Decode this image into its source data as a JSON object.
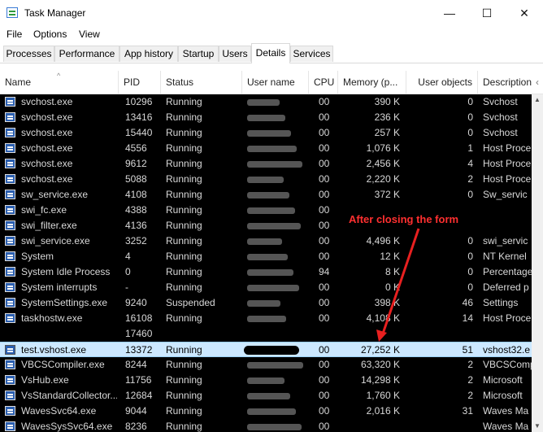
{
  "window": {
    "title": "Task Manager",
    "minimize_glyph": "—",
    "maximize_glyph": "☐",
    "close_glyph": "✕"
  },
  "menu": [
    "File",
    "Options",
    "View"
  ],
  "tabs": [
    "Processes",
    "Performance",
    "App history",
    "Startup",
    "Users",
    "Details",
    "Services"
  ],
  "active_tab": "Details",
  "columns": [
    "Name",
    "PID",
    "Status",
    "User name",
    "CPU",
    "Memory (p...",
    "User objects",
    "Description"
  ],
  "rows": [
    {
      "name": "svchost.exe",
      "pid": "10296",
      "status": "Running",
      "cpu": "00",
      "mem": "390 K",
      "uo": "0",
      "desc": "Svchost"
    },
    {
      "name": "svchost.exe",
      "pid": "13416",
      "status": "Running",
      "cpu": "00",
      "mem": "236 K",
      "uo": "0",
      "desc": "Svchost"
    },
    {
      "name": "svchost.exe",
      "pid": "15440",
      "status": "Running",
      "cpu": "00",
      "mem": "257 K",
      "uo": "0",
      "desc": "Svchost"
    },
    {
      "name": "svchost.exe",
      "pid": "4556",
      "status": "Running",
      "cpu": "00",
      "mem": "1,076 K",
      "uo": "1",
      "desc": "Host Proce"
    },
    {
      "name": "svchost.exe",
      "pid": "9612",
      "status": "Running",
      "cpu": "00",
      "mem": "2,456 K",
      "uo": "4",
      "desc": "Host Proce"
    },
    {
      "name": "svchost.exe",
      "pid": "5088",
      "status": "Running",
      "cpu": "00",
      "mem": "2,220 K",
      "uo": "2",
      "desc": "Host Proce"
    },
    {
      "name": "sw_service.exe",
      "pid": "4108",
      "status": "Running",
      "cpu": "00",
      "mem": "372 K",
      "uo": "0",
      "desc": "Sw_servic"
    },
    {
      "name": "swi_fc.exe",
      "pid": "4388",
      "status": "Running",
      "cpu": "00",
      "mem": "",
      "uo": "",
      "desc": ""
    },
    {
      "name": "swi_filter.exe",
      "pid": "4136",
      "status": "Running",
      "cpu": "00",
      "mem": "",
      "uo": "",
      "desc": ""
    },
    {
      "name": "swi_service.exe",
      "pid": "3252",
      "status": "Running",
      "cpu": "00",
      "mem": "4,496 K",
      "uo": "0",
      "desc": "swi_servic"
    },
    {
      "name": "System",
      "pid": "4",
      "status": "Running",
      "cpu": "00",
      "mem": "12 K",
      "uo": "0",
      "desc": "NT Kernel"
    },
    {
      "name": "System Idle Process",
      "pid": "0",
      "status": "Running",
      "cpu": "94",
      "mem": "8 K",
      "uo": "0",
      "desc": "Percentage"
    },
    {
      "name": "System interrupts",
      "pid": "-",
      "status": "Running",
      "cpu": "00",
      "mem": "0 K",
      "uo": "0",
      "desc": "Deferred p"
    },
    {
      "name": "SystemSettings.exe",
      "pid": "9240",
      "status": "Suspended",
      "cpu": "00",
      "mem": "398 K",
      "uo": "46",
      "desc": "Settings"
    },
    {
      "name": "taskhostw.exe",
      "pid": "16108",
      "status": "Running",
      "cpu": "00",
      "mem": "4,108 K",
      "uo": "14",
      "desc": "Host Proce"
    },
    {
      "name": "",
      "pid": "17460",
      "status": "",
      "cpu": "",
      "mem": "",
      "uo": "",
      "desc": ""
    },
    {
      "name": "test.vshost.exe",
      "pid": "13372",
      "status": "Running",
      "cpu": "00",
      "mem": "27,252 K",
      "uo": "51",
      "desc": "vshost32.e",
      "highlight": true
    },
    {
      "name": "VBCSCompiler.exe",
      "pid": "8244",
      "status": "Running",
      "cpu": "00",
      "mem": "63,320 K",
      "uo": "2",
      "desc": "VBCSComp"
    },
    {
      "name": "VsHub.exe",
      "pid": "11756",
      "status": "Running",
      "cpu": "00",
      "mem": "14,298 K",
      "uo": "2",
      "desc": "Microsoft"
    },
    {
      "name": "VsStandardCollector...",
      "pid": "12684",
      "status": "Running",
      "cpu": "00",
      "mem": "1,760 K",
      "uo": "2",
      "desc": "Microsoft"
    },
    {
      "name": "WavesSvc64.exe",
      "pid": "9044",
      "status": "Running",
      "cpu": "00",
      "mem": "2,016 K",
      "uo": "31",
      "desc": "Waves Ma"
    },
    {
      "name": "WavesSysSvc64.exe",
      "pid": "8236",
      "status": "Running",
      "cpu": "00",
      "mem": "",
      "uo": "",
      "desc": "Waves Ma"
    }
  ],
  "annotation": "After closing the form",
  "colors": {
    "annotation": "#ff2020",
    "highlight_row": "#cce8ff",
    "tab_active": "#ffffff"
  }
}
